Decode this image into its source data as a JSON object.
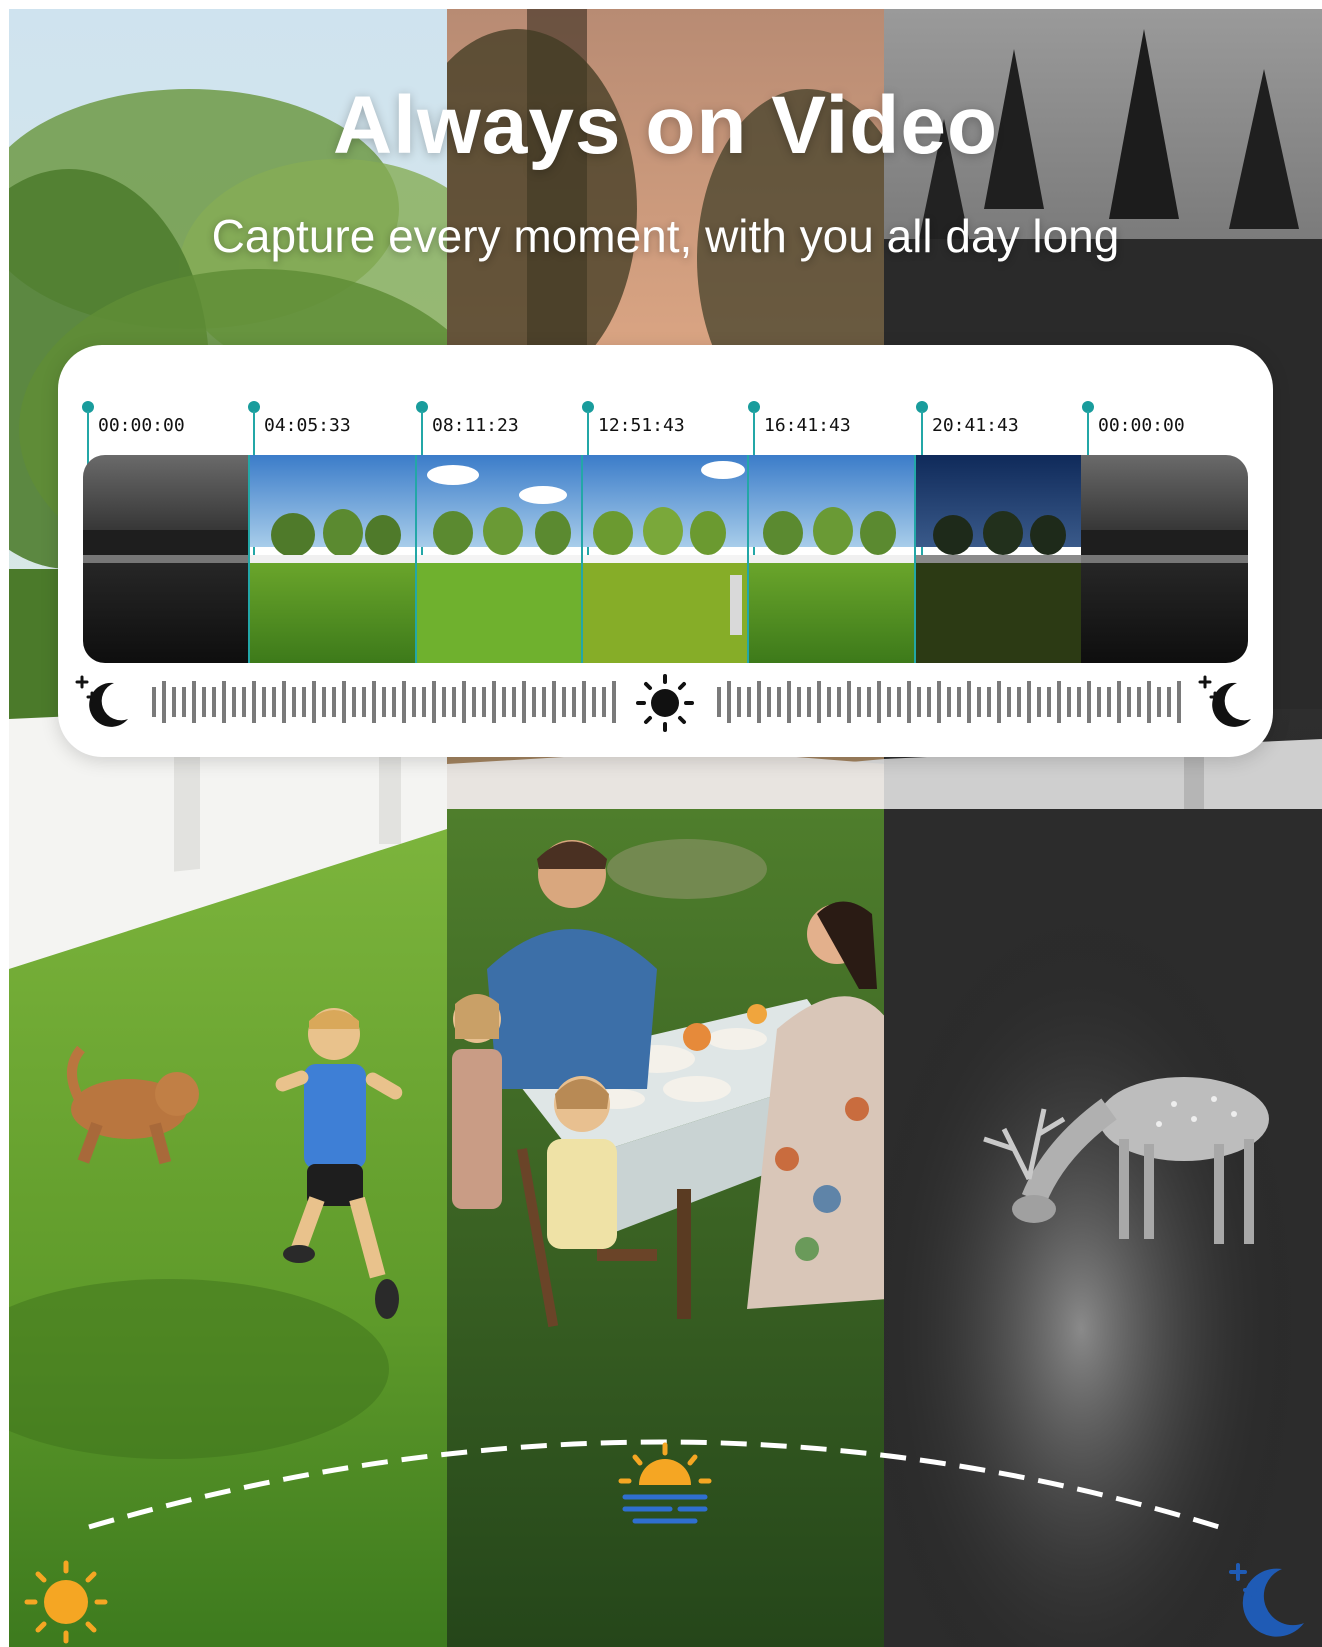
{
  "headline": "Always on Video",
  "subheadline": "Capture every moment, with you all day long",
  "timeline": {
    "timestamps": [
      "00:00:00",
      "04:05:33",
      "08:11:23",
      "12:51:43",
      "16:41:43",
      "20:41:43",
      "00:00:00"
    ],
    "frames": [
      "night",
      "morning",
      "day",
      "noon",
      "afternoon",
      "dusk",
      "night"
    ],
    "accent_color": "#1f9e9e",
    "icons": {
      "left": "moon-stars-icon",
      "center": "sun-icon",
      "right": "moon-stars-icon"
    }
  },
  "scenes": [
    {
      "name": "day",
      "content": "child-and-dog-running"
    },
    {
      "name": "dusk",
      "content": "family-dinner"
    },
    {
      "name": "night",
      "content": "deer-grazing-infrared"
    }
  ],
  "day_arc": {
    "icons": [
      "sun-icon",
      "sunset-icon",
      "moon-stars-icon"
    ],
    "colors": {
      "sun": "#f5a623",
      "moon": "#1f5bb5",
      "sunset_lines": "#2f6fd0"
    }
  }
}
